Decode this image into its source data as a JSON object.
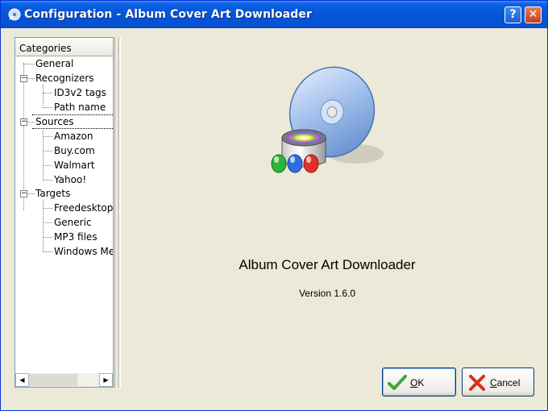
{
  "window": {
    "title": "Configuration - Album Cover Art Downloader",
    "help_label": "?",
    "close_label": "✕"
  },
  "tree": {
    "header": "Categories",
    "items": [
      {
        "label": "General"
      },
      {
        "label": "Recognizers",
        "expander": "−"
      },
      {
        "label": "ID3v2 tags"
      },
      {
        "label": "Path name"
      },
      {
        "label": "Sources",
        "expander": "−"
      },
      {
        "label": "Amazon"
      },
      {
        "label": "Buy.com"
      },
      {
        "label": "Walmart"
      },
      {
        "label": "Yahoo!"
      },
      {
        "label": "Targets",
        "expander": "−"
      },
      {
        "label": "Freedesktop.org"
      },
      {
        "label": "Generic"
      },
      {
        "label": "MP3 files"
      },
      {
        "label": "Windows Media Player"
      }
    ],
    "selected": "Sources",
    "scroll_left": "◀",
    "scroll_right": "▶"
  },
  "about": {
    "app_name": "Album Cover Art Downloader",
    "version": "Version 1.6.0"
  },
  "buttons": {
    "ok_mnemonic": "O",
    "ok_rest": "K",
    "cancel_mnemonic": "C",
    "cancel_rest": "ancel"
  },
  "icons": {
    "app": "cd-app-icon",
    "ok": "green-checkmark-icon",
    "cancel": "red-x-icon",
    "art": "cd-with-paint-bucket-icon"
  },
  "colors": {
    "title_bar": "#0556d9",
    "title_text": "#ffffff",
    "dialog_bg": "#ece9d8",
    "close_button": "#c2401d",
    "ok_check": "#3da83a",
    "cancel_x": "#d7301a"
  }
}
